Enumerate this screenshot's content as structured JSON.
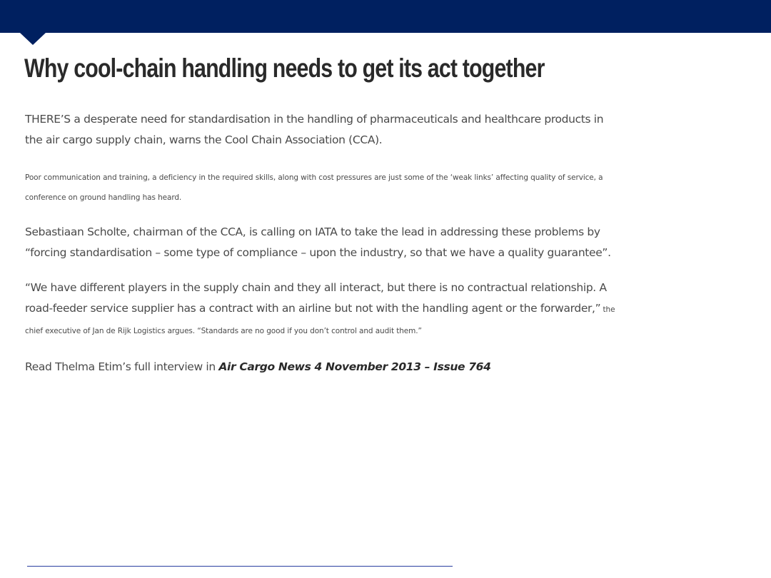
{
  "header": {
    "bar_color": "#002060"
  },
  "article": {
    "title": "Why cool-chain handling needs to get its act together",
    "para1": "THERE’S a desperate need for standardisation in the handling of pharmaceuticals and healthcare products in the air cargo supply chain, warns the Cool Chain Association (CCA).",
    "para2": "Poor communication and training, a deficiency in the required skills, along with cost pressures are just some of the ‘weak links’ affecting quality of service, a conference on ground handling has heard.",
    "para3": "Sebastiaan Scholte, chairman of the CCA, is calling on IATA to take the lead in addressing these problems by “forcing standardisation – some type of compliance – upon the industry, so that we have a quality guarantee”.",
    "para4_quote": "“We have different players in the supply chain and they all interact, but there is no contractual relationship. A road-feeder service supplier has a contract with an airline but not with the handling agent or the forwarder,”",
    "para4_attribution": " the chief executive of Jan de Rijk Logistics argues. “Standards are no good if you don’t control and audit them.”",
    "para5_lead": "Read Thelma Etim’s full interview in ",
    "para5_source": "Air Cargo News 4 November 2013 – Issue 764"
  }
}
